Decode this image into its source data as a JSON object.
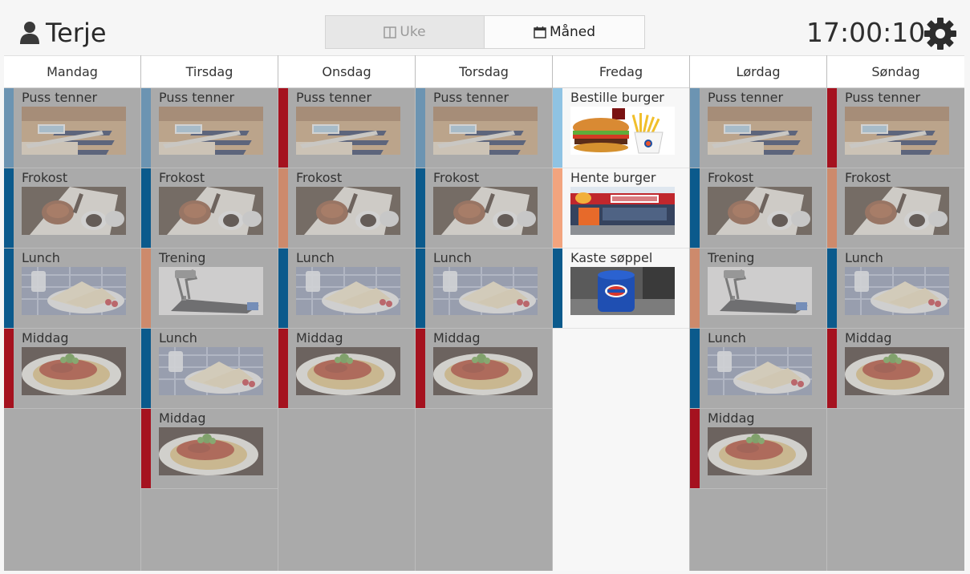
{
  "header": {
    "user_name": "Terje",
    "view_week_label": "Uke",
    "view_month_label": "Måned",
    "clock": "17:00:10"
  },
  "colors": {
    "light_blue": "#6c94b2",
    "dark_blue": "#0b5a8c",
    "red": "#a5121f",
    "salmon": "#cd8a6c",
    "sky": "#8fc3e3",
    "peach": "#f2a47e"
  },
  "days": [
    {
      "name": "Mandag",
      "today": false,
      "activities": [
        {
          "label": "Puss tenner",
          "image": "toothbrush",
          "color": "#6c94b2"
        },
        {
          "label": "Frokost",
          "image": "breakfast",
          "color": "#0b5a8c"
        },
        {
          "label": "Lunch",
          "image": "sandwich",
          "color": "#0b5a8c"
        },
        {
          "label": "Middag",
          "image": "spaghetti",
          "color": "#a5121f"
        }
      ]
    },
    {
      "name": "Tirsdag",
      "today": false,
      "activities": [
        {
          "label": "Puss tenner",
          "image": "toothbrush",
          "color": "#6c94b2"
        },
        {
          "label": "Frokost",
          "image": "breakfast",
          "color": "#0b5a8c"
        },
        {
          "label": "Trening",
          "image": "treadmill",
          "color": "#cd8a6c"
        },
        {
          "label": "Lunch",
          "image": "sandwich",
          "color": "#0b5a8c"
        },
        {
          "label": "Middag",
          "image": "spaghetti",
          "color": "#a5121f"
        }
      ]
    },
    {
      "name": "Onsdag",
      "today": false,
      "activities": [
        {
          "label": "Puss tenner",
          "image": "toothbrush",
          "color": "#a5121f"
        },
        {
          "label": "Frokost",
          "image": "breakfast",
          "color": "#cd8a6c"
        },
        {
          "label": "Lunch",
          "image": "sandwich",
          "color": "#0b5a8c"
        },
        {
          "label": "Middag",
          "image": "spaghetti",
          "color": "#a5121f"
        }
      ]
    },
    {
      "name": "Torsdag",
      "today": false,
      "activities": [
        {
          "label": "Puss tenner",
          "image": "toothbrush",
          "color": "#6c94b2"
        },
        {
          "label": "Frokost",
          "image": "breakfast",
          "color": "#0b5a8c"
        },
        {
          "label": "Lunch",
          "image": "sandwich",
          "color": "#0b5a8c"
        },
        {
          "label": "Middag",
          "image": "spaghetti",
          "color": "#a5121f"
        }
      ]
    },
    {
      "name": "Fredag",
      "today": true,
      "activities": [
        {
          "label": "Bestille burger",
          "image": "burger",
          "color": "#8fc3e3"
        },
        {
          "label": "Hente burger",
          "image": "restaurant",
          "color": "#f2a47e"
        },
        {
          "label": "Kaste søppel",
          "image": "trashcan",
          "color": "#0b5a8c"
        }
      ]
    },
    {
      "name": "Lørdag",
      "today": false,
      "activities": [
        {
          "label": "Puss tenner",
          "image": "toothbrush",
          "color": "#6c94b2"
        },
        {
          "label": "Frokost",
          "image": "breakfast",
          "color": "#0b5a8c"
        },
        {
          "label": "Trening",
          "image": "treadmill",
          "color": "#cd8a6c"
        },
        {
          "label": "Lunch",
          "image": "sandwich",
          "color": "#0b5a8c"
        },
        {
          "label": "Middag",
          "image": "spaghetti",
          "color": "#a5121f"
        }
      ]
    },
    {
      "name": "Søndag",
      "today": false,
      "activities": [
        {
          "label": "Puss tenner",
          "image": "toothbrush",
          "color": "#a5121f"
        },
        {
          "label": "Frokost",
          "image": "breakfast",
          "color": "#cd8a6c"
        },
        {
          "label": "Lunch",
          "image": "sandwich",
          "color": "#0b5a8c"
        },
        {
          "label": "Middag",
          "image": "spaghetti",
          "color": "#a5121f"
        }
      ]
    }
  ]
}
